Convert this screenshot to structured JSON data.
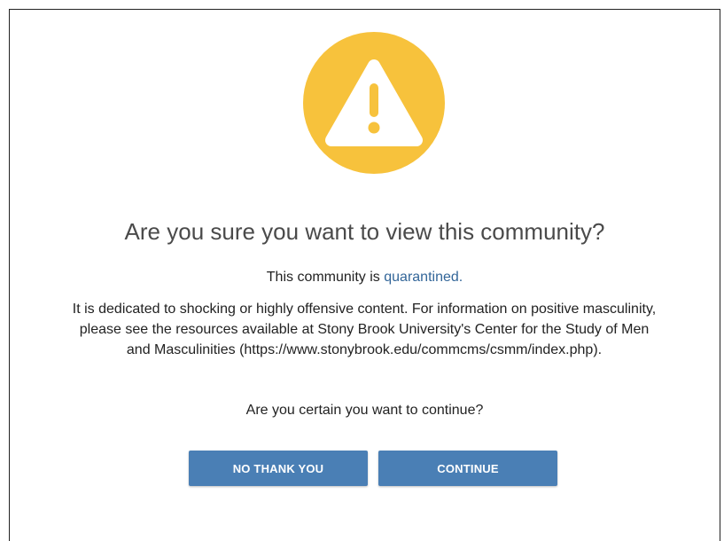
{
  "icon": {
    "name": "warning-icon",
    "background_color": "#f7c23c",
    "glyph_color": "#ffffff"
  },
  "dialog": {
    "title": "Are you sure you want to view this community?",
    "quarantine_prefix": "This community is ",
    "quarantine_link": "quarantined.",
    "description": "It is dedicated to shocking or highly offensive content. For information on positive masculinity, please see the resources available at Stony Brook University's Center for the Study of Men and Masculinities (https://www.stonybrook.edu/commcms/csmm/index.php).",
    "confirm_question": "Are you certain you want to continue?"
  },
  "buttons": {
    "decline_label": "NO THANK YOU",
    "continue_label": "CONTINUE",
    "color": "#4a7fb5"
  },
  "colors": {
    "link": "#336699"
  }
}
